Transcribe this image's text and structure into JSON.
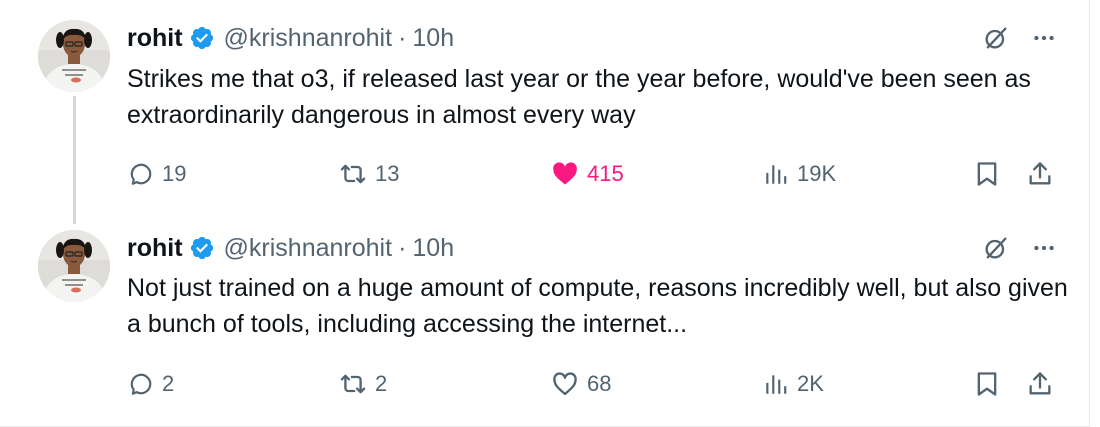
{
  "accent": "#1d9bf0",
  "like_color": "#f91880",
  "tweets": [
    {
      "author": {
        "name": "rohit",
        "handle": "@krishnanrohit",
        "verified": true,
        "avatar": "avatar-photo"
      },
      "separator": "·",
      "time": "10h",
      "text": "Strikes me that o3, if released last year or the year before, would've been seen as extraordinarily dangerous in almost every way",
      "stats": {
        "replies": "19",
        "retweets": "13",
        "likes": "415",
        "views": "19K"
      },
      "liked": true
    },
    {
      "author": {
        "name": "rohit",
        "handle": "@krishnanrohit",
        "verified": true,
        "avatar": "avatar-photo"
      },
      "separator": "·",
      "time": "10h",
      "text": "Not just trained on a huge amount of compute, reasons incredibly well, but also given a bunch of tools, including accessing the internet...",
      "stats": {
        "replies": "2",
        "retweets": "2",
        "likes": "68",
        "views": "2K"
      },
      "liked": false
    }
  ],
  "icons": {
    "verified": "verified-badge-icon",
    "grok": "grok-icon",
    "more": "more-icon",
    "reply": "reply-icon",
    "retweet": "retweet-icon",
    "like": "heart-icon",
    "views": "views-icon",
    "bookmark": "bookmark-icon",
    "share": "share-icon"
  }
}
